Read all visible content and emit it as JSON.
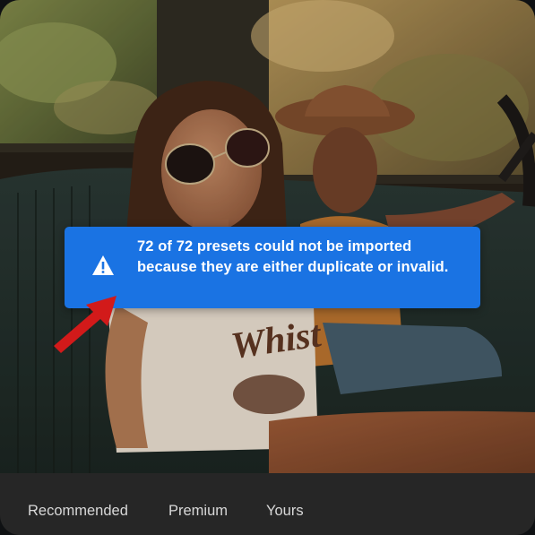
{
  "notification": {
    "message": "72 of 72 presets could not be imported because they are either duplicate or invalid.",
    "icon": "warning-icon",
    "color": "#1a73e3"
  },
  "annotation": {
    "icon": "arrow-pointer-icon",
    "color": "#d21a1a"
  },
  "photo": {
    "shirt_print": "Whist"
  },
  "tabs": [
    {
      "label": "Recommended"
    },
    {
      "label": "Premium"
    },
    {
      "label": "Yours"
    }
  ]
}
